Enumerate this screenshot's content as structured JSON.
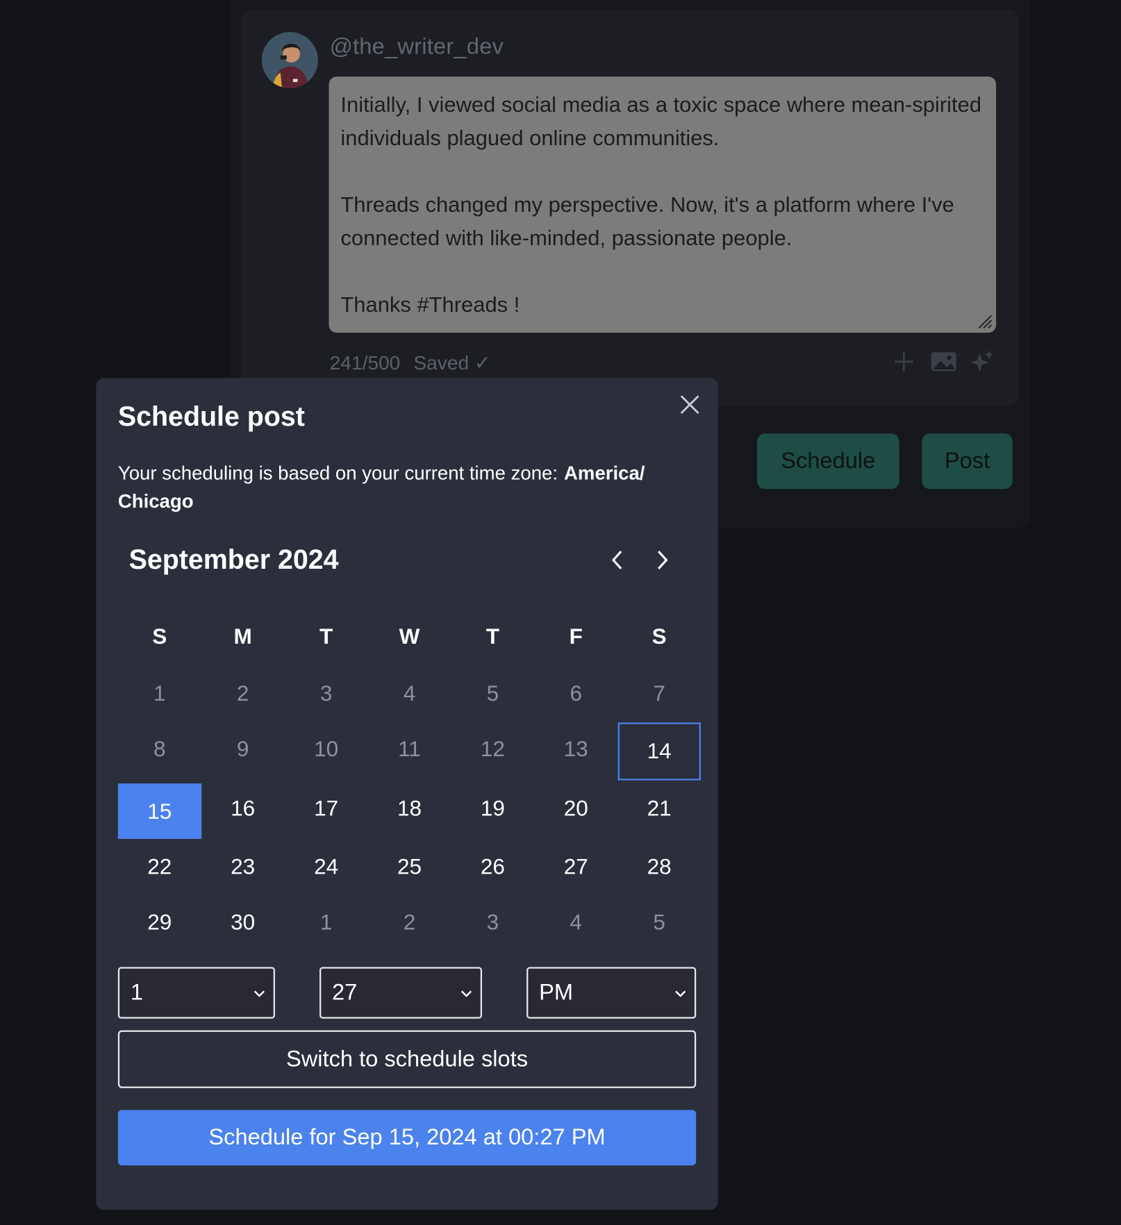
{
  "composer": {
    "username": "@the_writer_dev",
    "post_paragraphs": [
      "Initially, I viewed social media as a toxic space where mean-spirited individuals plagued online communities.",
      "Threads changed my perspective. Now, it's a platform where I've connected with like-minded, passionate people.",
      "Thanks #Threads !"
    ],
    "char_count": "241/500",
    "save_status": "Saved ✓",
    "tools": [
      "plus-icon",
      "image-icon",
      "sparkle-icon"
    ]
  },
  "actions": {
    "schedule_label": "Schedule",
    "post_label": "Post"
  },
  "modal": {
    "title": "Schedule post",
    "timezone_text": "Your scheduling is based on your current time zone:",
    "timezone_value": "America/ Chicago",
    "close_icon": "close-icon"
  },
  "calendar": {
    "month_label": "September 2024",
    "weekdays": [
      "S",
      "M",
      "T",
      "W",
      "T",
      "F",
      "S"
    ],
    "days": [
      {
        "n": "1",
        "state": "muted"
      },
      {
        "n": "2",
        "state": "muted"
      },
      {
        "n": "3",
        "state": "muted"
      },
      {
        "n": "4",
        "state": "muted"
      },
      {
        "n": "5",
        "state": "muted"
      },
      {
        "n": "6",
        "state": "muted"
      },
      {
        "n": "7",
        "state": "muted"
      },
      {
        "n": "8",
        "state": "muted"
      },
      {
        "n": "9",
        "state": "muted"
      },
      {
        "n": "10",
        "state": "muted"
      },
      {
        "n": "11",
        "state": "muted"
      },
      {
        "n": "12",
        "state": "muted"
      },
      {
        "n": "13",
        "state": "muted"
      },
      {
        "n": "14",
        "state": "today"
      },
      {
        "n": "15",
        "state": "selected"
      },
      {
        "n": "16",
        "state": "active"
      },
      {
        "n": "17",
        "state": "active"
      },
      {
        "n": "18",
        "state": "active"
      },
      {
        "n": "19",
        "state": "active"
      },
      {
        "n": "20",
        "state": "active"
      },
      {
        "n": "21",
        "state": "active"
      },
      {
        "n": "22",
        "state": "active"
      },
      {
        "n": "23",
        "state": "active"
      },
      {
        "n": "24",
        "state": "active"
      },
      {
        "n": "25",
        "state": "active"
      },
      {
        "n": "26",
        "state": "active"
      },
      {
        "n": "27",
        "state": "active"
      },
      {
        "n": "28",
        "state": "active"
      },
      {
        "n": "29",
        "state": "active"
      },
      {
        "n": "30",
        "state": "active"
      },
      {
        "n": "1",
        "state": "muted"
      },
      {
        "n": "2",
        "state": "muted"
      },
      {
        "n": "3",
        "state": "muted"
      },
      {
        "n": "4",
        "state": "muted"
      },
      {
        "n": "5",
        "state": "muted"
      }
    ]
  },
  "time": {
    "hour": "1",
    "minute": "27",
    "ampm": "PM"
  },
  "buttons": {
    "switch_label": "Switch to schedule slots",
    "confirm_label": "Schedule for Sep 15, 2024 at 00:27 PM"
  },
  "colors": {
    "accent": "#4b82ed",
    "modal_bg": "#2a2f3b",
    "page_bg": "#121317",
    "action_green": "#1e4d45"
  }
}
